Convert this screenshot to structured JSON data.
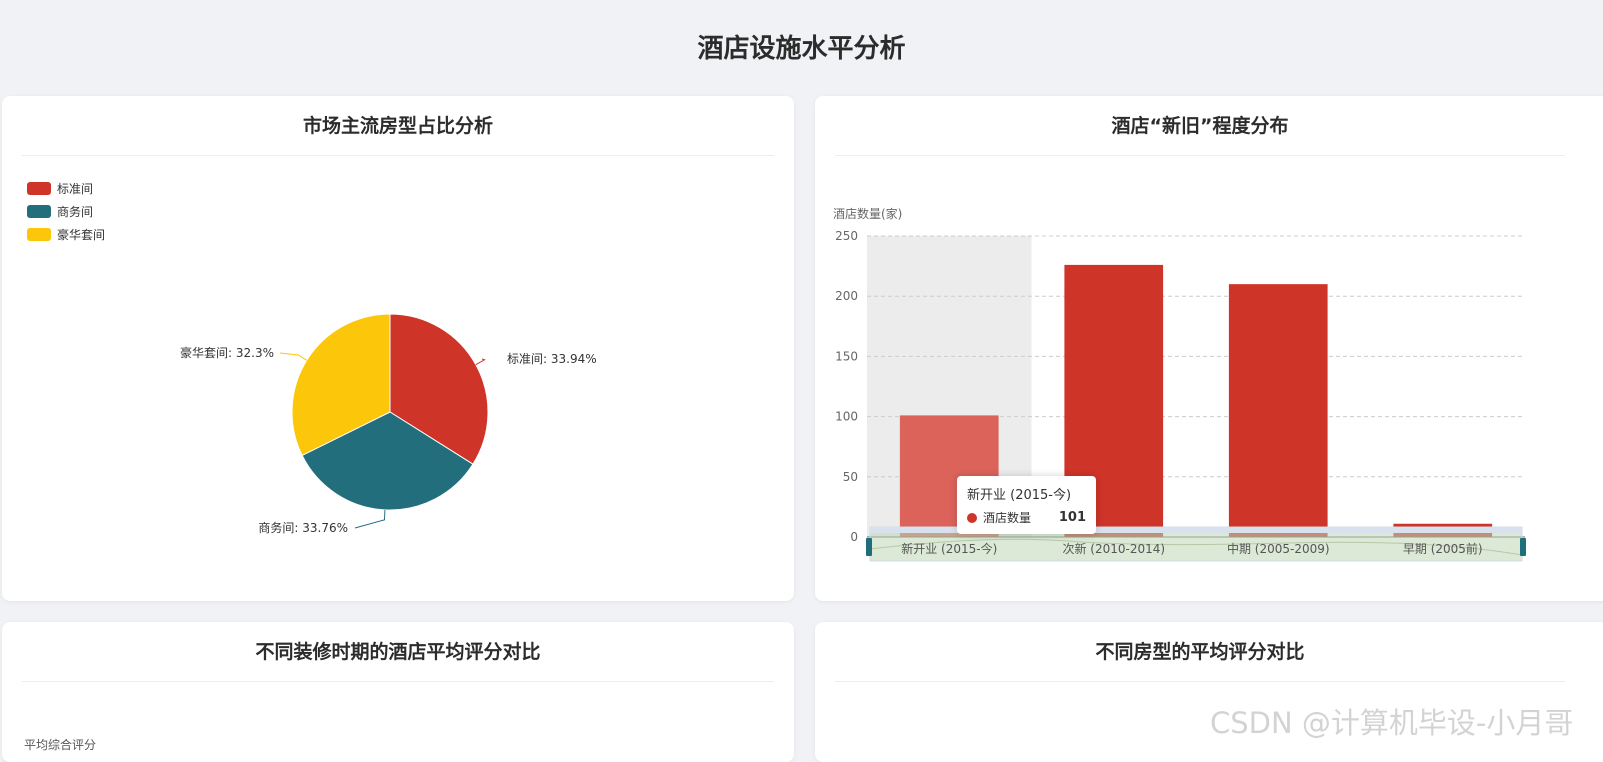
{
  "page": {
    "title": "酒店设施水平分析"
  },
  "watermark": "CSDN @计算机毕设-小月哥",
  "cards": {
    "room_share": {
      "title": "市场主流房型占比分析"
    },
    "hotel_age": {
      "title": "酒店“新旧”程度分布"
    },
    "reno_score": {
      "title": "不同装修时期的酒店平均评分对比",
      "ylabel": "平均综合评分"
    },
    "room_score": {
      "title": "不同房型的平均评分对比"
    }
  },
  "tooltip": {
    "title": "新开业 (2015-今)",
    "series": "酒店数量",
    "value": "101",
    "color": "#cf3428"
  },
  "chart_data": [
    {
      "type": "pie",
      "legend_position": "top-left",
      "legend": [
        "标准间",
        "商务间",
        "豪华套间"
      ],
      "slices": [
        {
          "name": "标准间",
          "value": 33.94,
          "label": "标准间: 33.94%",
          "color": "#cf3428"
        },
        {
          "name": "商务间",
          "value": 33.76,
          "label": "商务间: 33.76%",
          "color": "#226e7d"
        },
        {
          "name": "豪华套间",
          "value": 32.3,
          "label": "豪华套间: 32.3%",
          "color": "#fcc60a"
        }
      ]
    },
    {
      "type": "bar",
      "ylabel": "酒店数量(家)",
      "ylim": [
        0,
        250
      ],
      "yticks": [
        0,
        50,
        100,
        150,
        200,
        250
      ],
      "grid": true,
      "categories": [
        "新开业 (2015-今)",
        "次新 (2010-2014)",
        "中期 (2005-2009)",
        "早期 (2005前)"
      ],
      "values": [
        101,
        226,
        210,
        11
      ],
      "color": "#cf3428",
      "highlight_color": "#db635a",
      "highlight_index": 0,
      "datazoom": true
    }
  ]
}
